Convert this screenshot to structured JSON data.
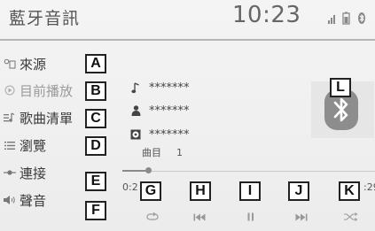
{
  "header": {
    "title": "藍牙音訊",
    "clock": "10:23",
    "status_icons": [
      "signal-bars-icon",
      "battery-icon",
      "bluetooth-icon"
    ]
  },
  "sidebar": {
    "items": [
      {
        "label": "來源",
        "icon": "source-icon",
        "callout": "A",
        "state": "normal"
      },
      {
        "label": "目前播放",
        "icon": "play-circle-icon",
        "callout": "B",
        "state": "selected"
      },
      {
        "label": "歌曲清單",
        "icon": "playlist-icon",
        "callout": "C",
        "state": "normal"
      },
      {
        "label": "瀏覽",
        "icon": "browse-list-icon",
        "callout": "D",
        "state": "normal"
      },
      {
        "label": "連接",
        "icon": "connect-icon",
        "callout": "E",
        "state": "normal"
      },
      {
        "label": "聲音",
        "icon": "speaker-icon",
        "callout": "F",
        "state": "normal"
      }
    ]
  },
  "track": {
    "song": "*******",
    "artist": "*******",
    "album": "*******",
    "track_label": "曲目",
    "track_number": "1"
  },
  "art": {
    "icon": "bluetooth-icon",
    "callout": "L"
  },
  "progress": {
    "elapsed": "0:2",
    "total": ":29",
    "fraction": 0.1
  },
  "controls": [
    {
      "icon": "repeat-icon",
      "callout": "G"
    },
    {
      "icon": "skip-back-icon",
      "callout": "H"
    },
    {
      "icon": "pause-icon",
      "callout": "I"
    },
    {
      "icon": "skip-forward-icon",
      "callout": "J"
    },
    {
      "icon": "shuffle-icon",
      "callout": "K"
    }
  ],
  "colors": {
    "background": "#efefef",
    "text": "#3a3a3a",
    "muted": "#b0b0b0",
    "accent": "#8d8d8d"
  }
}
